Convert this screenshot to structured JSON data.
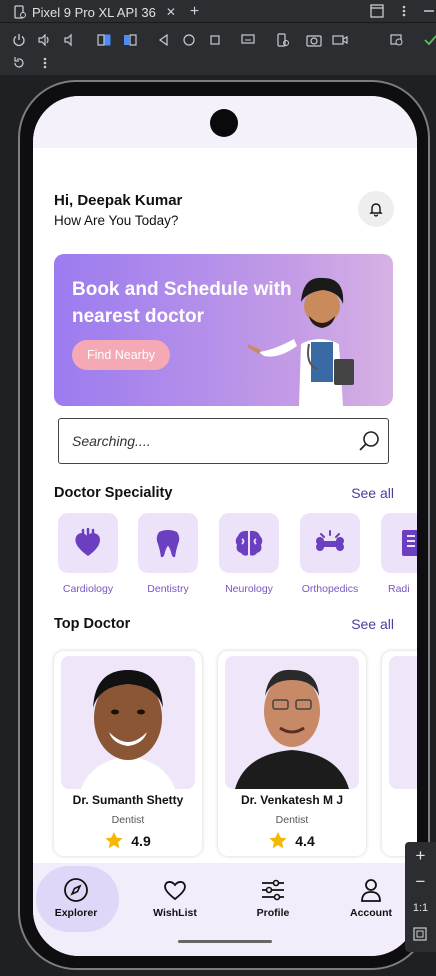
{
  "ide": {
    "device_tab": "Pixel 9 Pro XL API 36",
    "close_label": "✕",
    "add_label": "+",
    "zoom_in": "+",
    "zoom_out": "−",
    "zoom_reset": "1:1"
  },
  "greeting": {
    "name": "Hi, Deepak Kumar",
    "subtitle": "How Are You Today?"
  },
  "banner": {
    "title": "Book and Schedule with nearest doctor",
    "button": "Find Nearby"
  },
  "search": {
    "placeholder": "Searching...."
  },
  "speciality": {
    "title": "Doctor Speciality",
    "see_all": "See all",
    "items": [
      {
        "label": "Cardiology",
        "icon": "heart-icon"
      },
      {
        "label": "Dentistry",
        "icon": "tooth-icon"
      },
      {
        "label": "Neurology",
        "icon": "brain-icon"
      },
      {
        "label": "Orthopedics",
        "icon": "bone-icon"
      },
      {
        "label": "Radi",
        "icon": "xray-icon"
      }
    ]
  },
  "top_doctor": {
    "title": "Top Doctor",
    "see_all": "See all",
    "doctors": [
      {
        "name": "Dr. Sumanth Shetty",
        "specialty": "Dentist",
        "rating": "4.9"
      },
      {
        "name": "Dr. Venkatesh M J",
        "specialty": "Dentist",
        "rating": "4.4"
      }
    ]
  },
  "nav": {
    "items": [
      {
        "label": "Explorer",
        "icon": "compass-icon",
        "active": true
      },
      {
        "label": "WishList",
        "icon": "heart-outline-icon"
      },
      {
        "label": "Profile",
        "icon": "sliders-icon"
      },
      {
        "label": "Account",
        "icon": "person-icon"
      }
    ]
  },
  "colors": {
    "accent": "#7a55c4",
    "banner_start": "#9b7bf0",
    "banner_end": "#d6b2e4",
    "button_pink": "#f4a9b5",
    "star": "#f5b800"
  }
}
